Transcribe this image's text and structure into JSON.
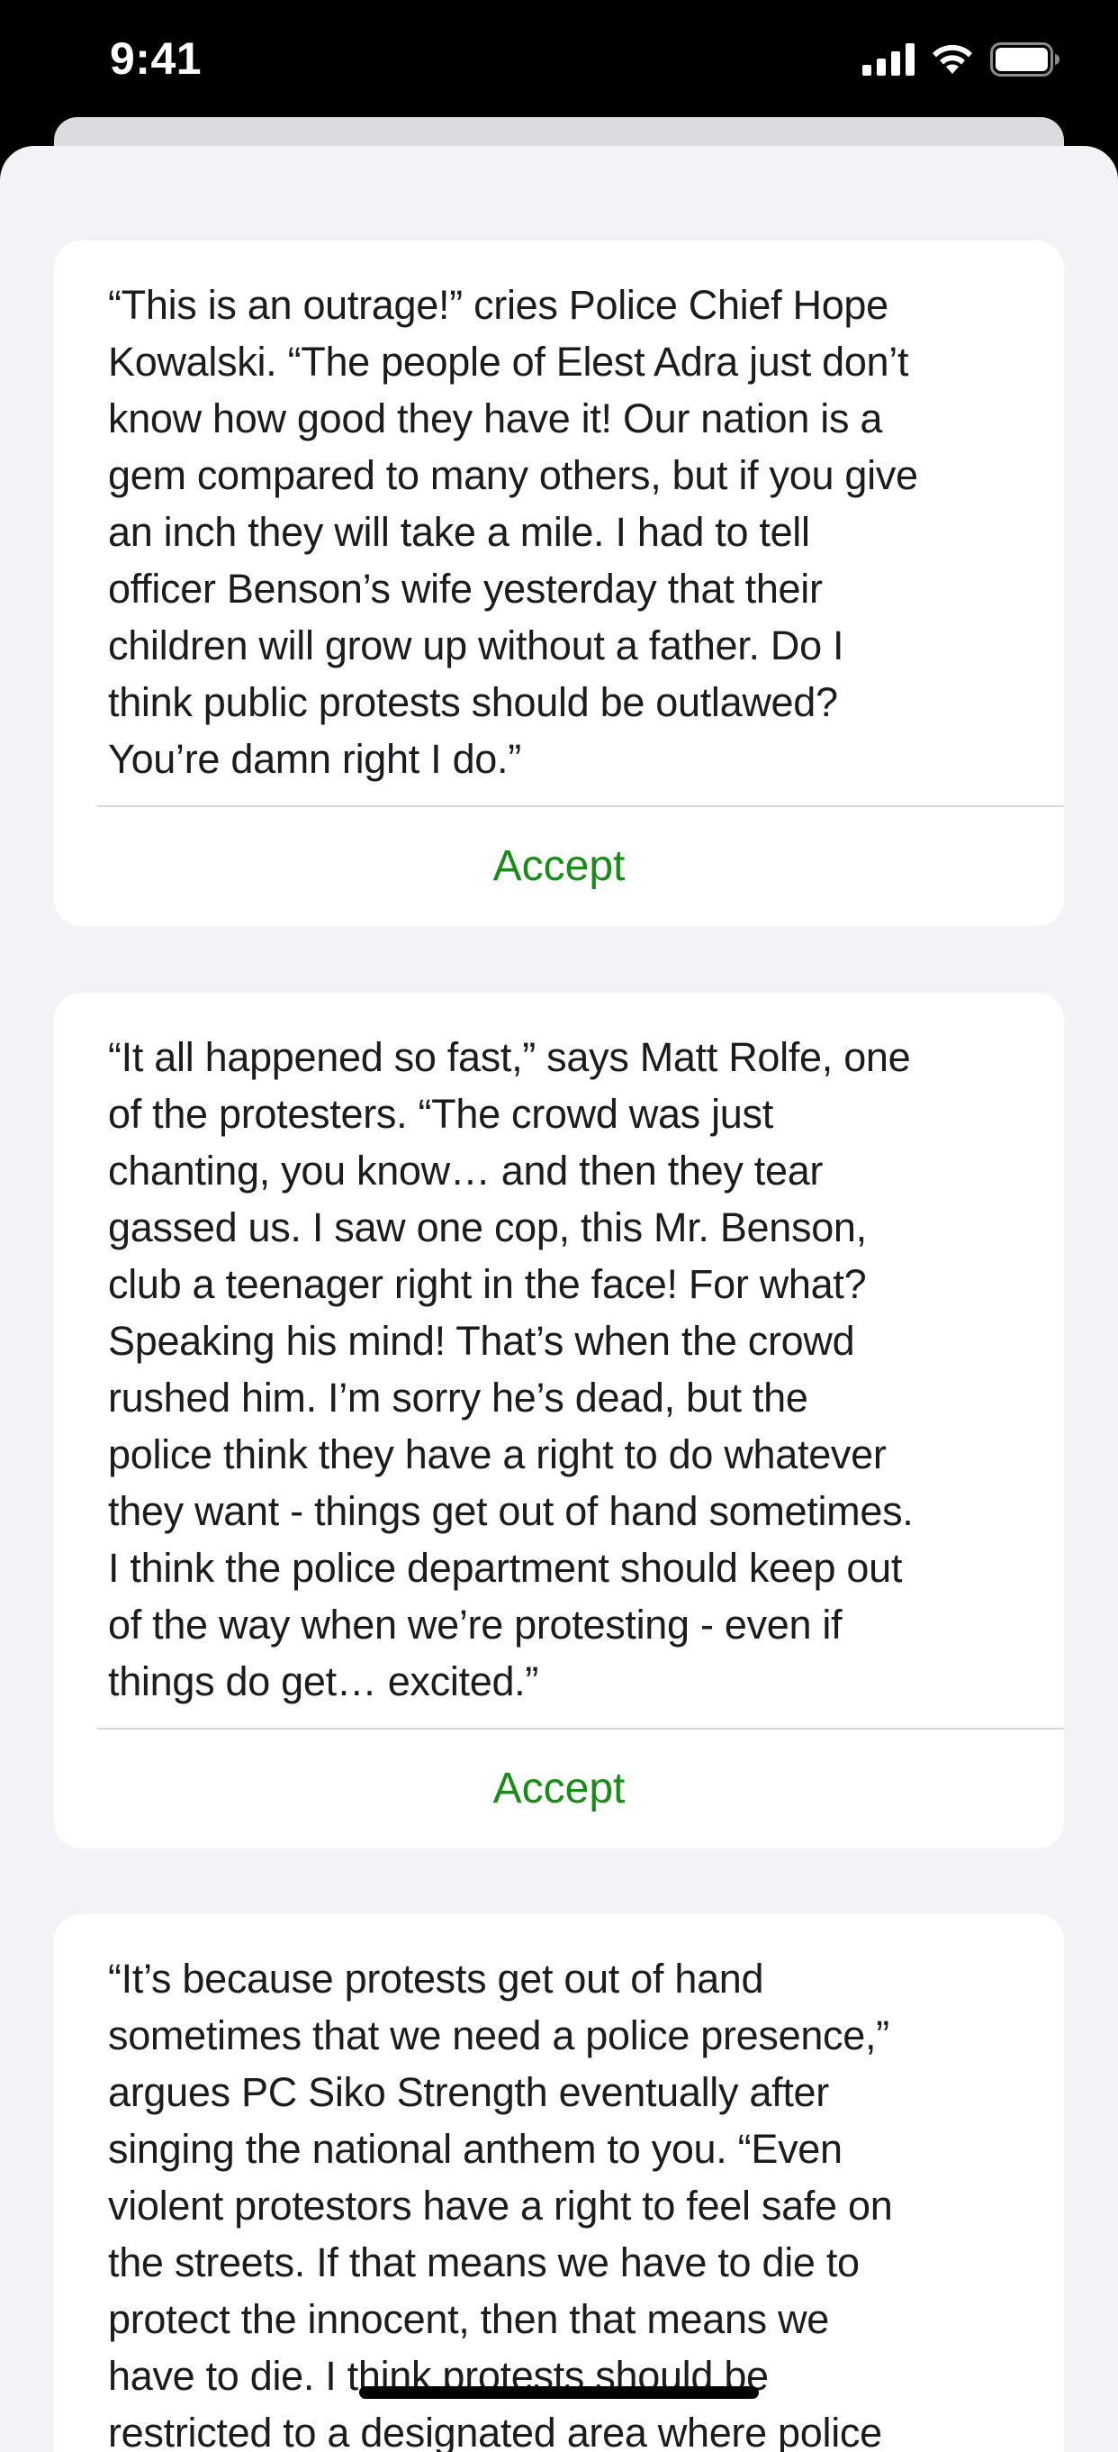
{
  "status_bar": {
    "time": "9:41"
  },
  "cards": [
    {
      "text": "“This is an outrage!” cries Police Chief Hope\nKowalski. “The people of Elest Adra just don’t\nknow how good they have it! Our nation is a\ngem compared to many others, but if you give\nan inch they will take a mile. I had to tell\nofficer Benson’s wife yesterday that their\nchildren will grow up without a father. Do I\nthink public protests should be outlawed?\nYou’re damn right I do.”",
      "action_label": "Accept"
    },
    {
      "text": "“It all happened so fast,” says Matt Rolfe, one\nof the protesters. “The crowd was just\nchanting, you know… and then they tear\ngassed us. I saw one cop, this Mr. Benson,\nclub a teenager right in the face! For what?\nSpeaking his mind! That’s when the crowd\nrushed him. I’m sorry he’s dead, but the\npolice think they have a right to do whatever\nthey want - things get out of hand sometimes.\nI think the police department should keep out\nof the way when we’re protesting - even if\nthings do get… excited.”",
      "action_label": "Accept"
    },
    {
      "text": "“It’s because protests get out of hand\nsometimes that we need a police presence,”\nargues PC Siko Strength eventually after\nsinging the national anthem to you. “Even\nviolent protestors have a right to feel safe on\nthe streets. If that means we have to die to\nprotect the innocent, then that means we\nhave to die. I think protests should be\nrestricted to a designated area where police"
    }
  ],
  "colors": {
    "accent": "#1a8a1a",
    "background": "#f2f2f7",
    "card": "#ffffff",
    "text": "#1c1c1e"
  },
  "icons": {
    "signal": "cellular-signal-icon",
    "wifi": "wifi-icon",
    "battery": "battery-icon"
  }
}
